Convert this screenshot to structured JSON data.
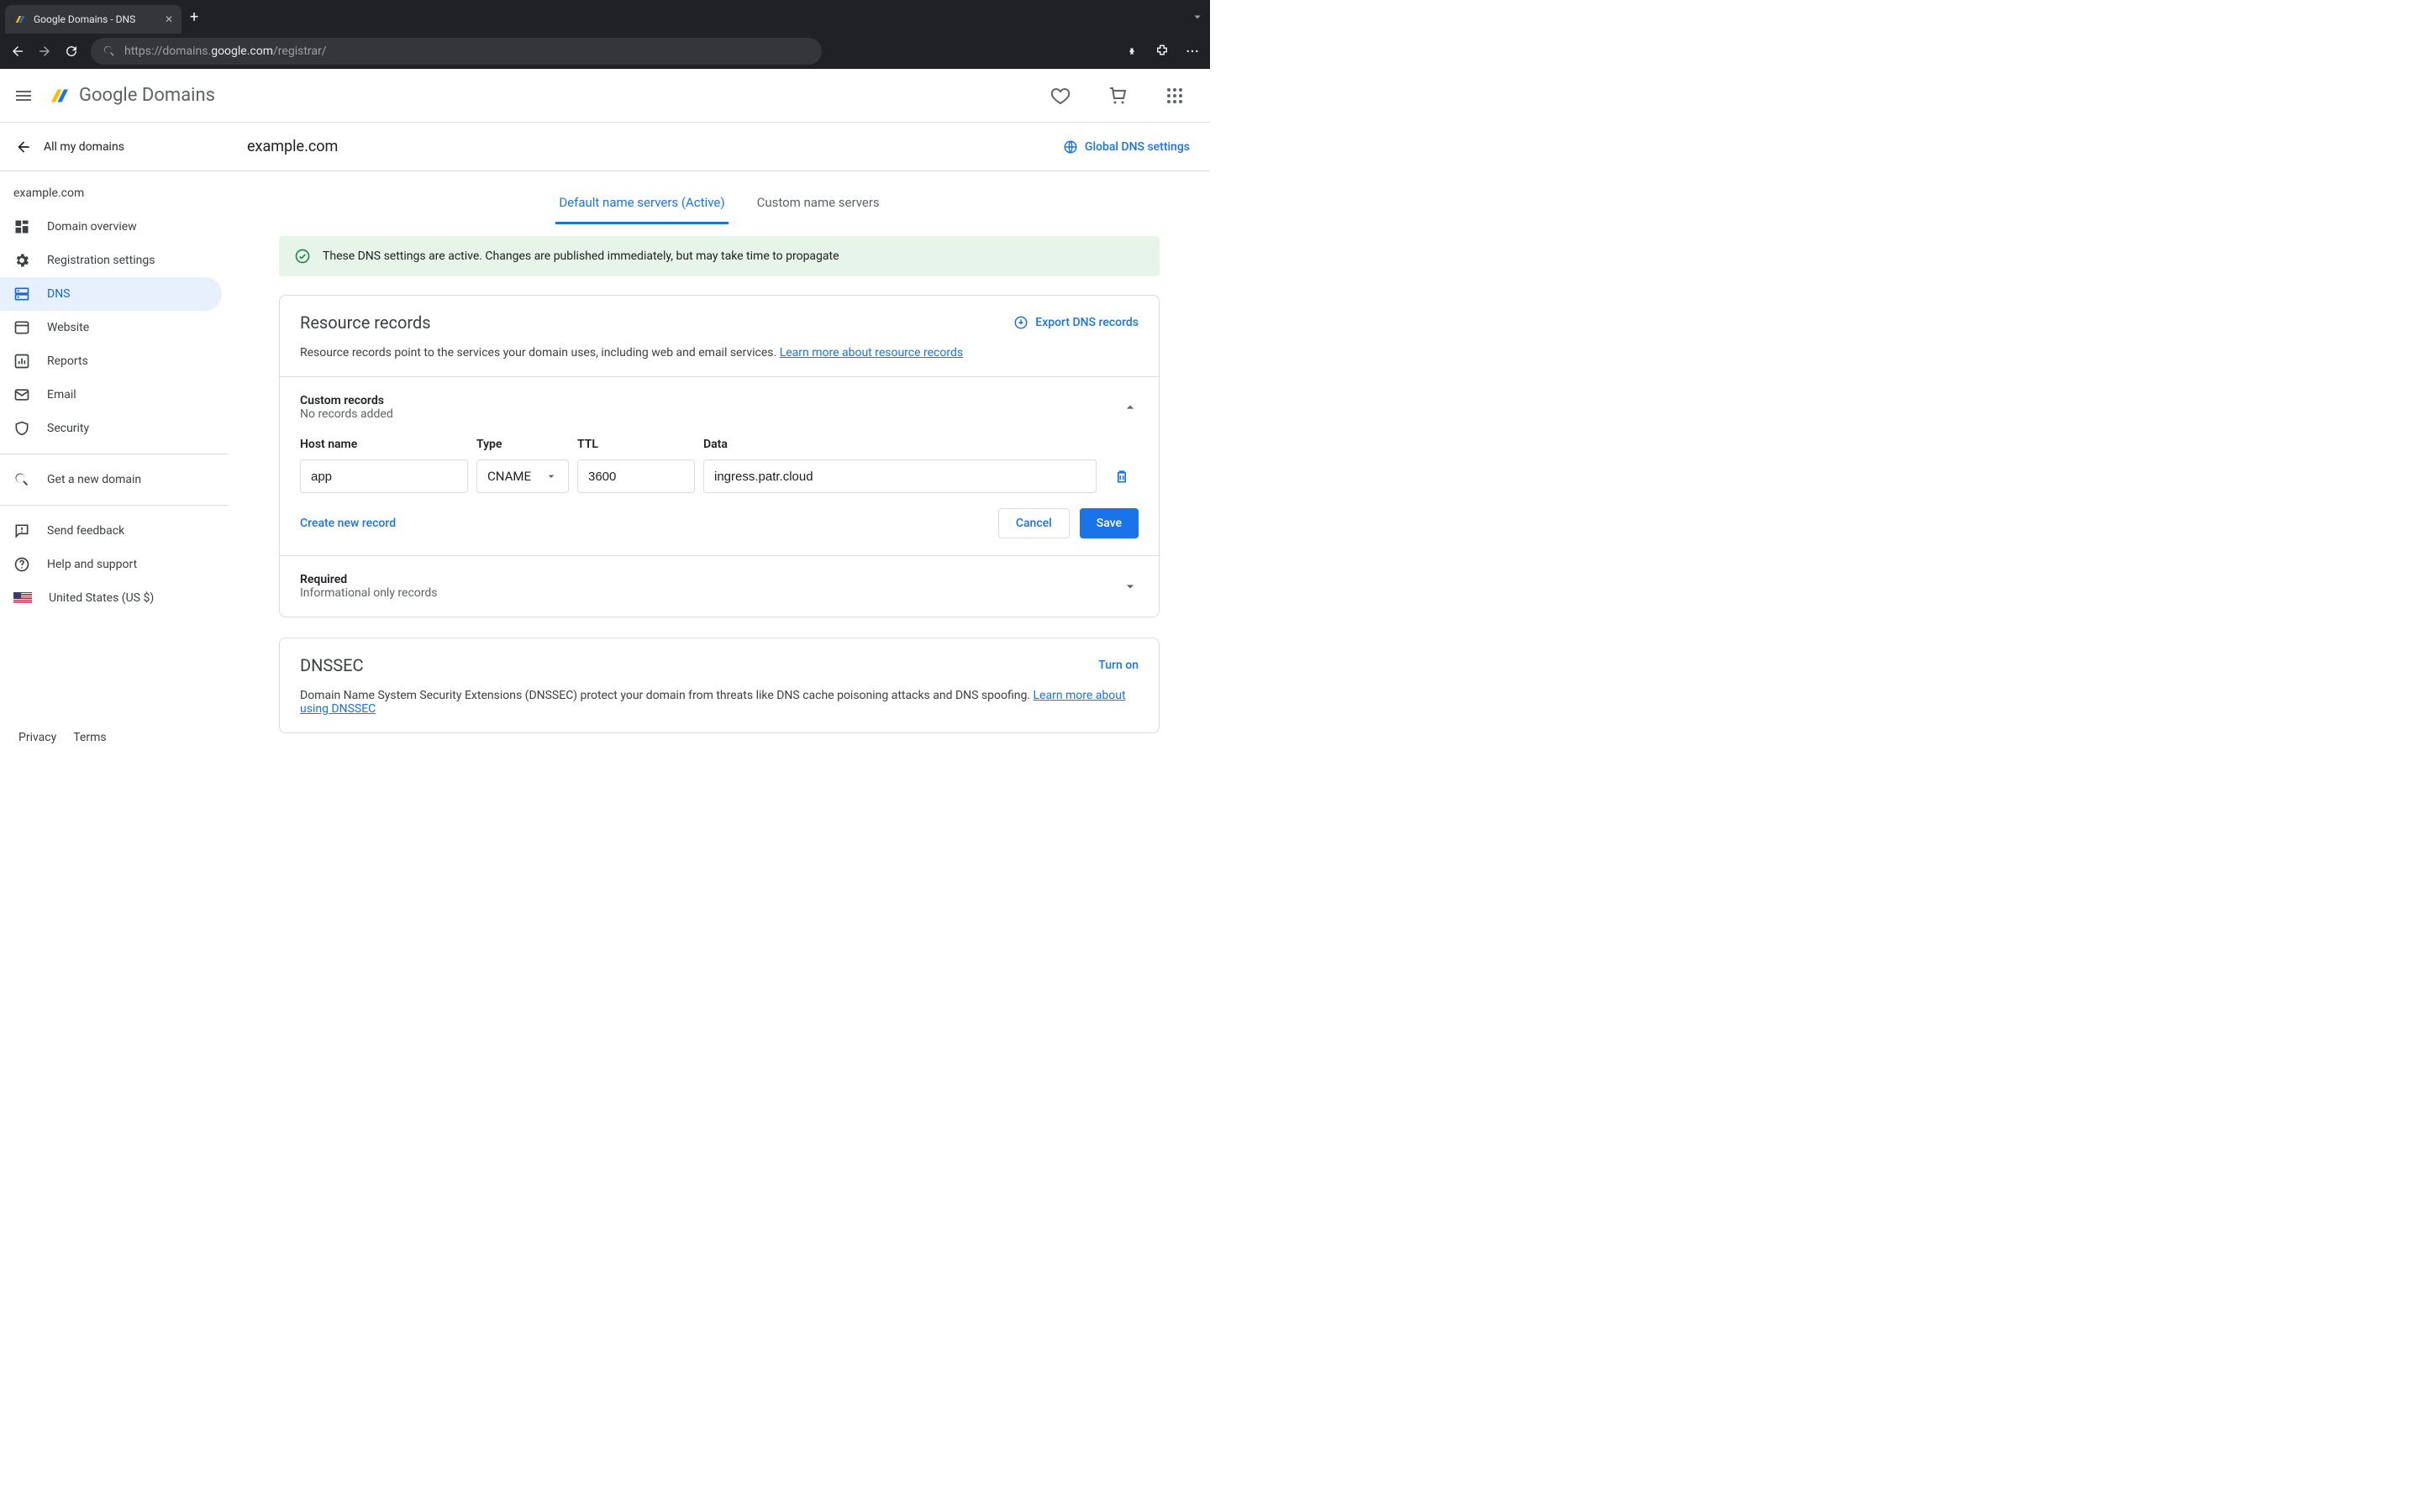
{
  "browser": {
    "tab_title": "Google Domains - DNS",
    "url_dim_pre": "https://domains.",
    "url_host": "google.com",
    "url_path": "/registrar/"
  },
  "header": {
    "product_left": "Google",
    "product_right": " Domains"
  },
  "subheader": {
    "back_label": "All my domains",
    "domain": "example.com",
    "global_dns": "Global DNS settings"
  },
  "sidebar": {
    "domain": "example.com",
    "items": [
      {
        "label": "Domain overview"
      },
      {
        "label": "Registration settings"
      },
      {
        "label": "DNS"
      },
      {
        "label": "Website"
      },
      {
        "label": "Reports"
      },
      {
        "label": "Email"
      },
      {
        "label": "Security"
      }
    ],
    "get_new": "Get a new domain",
    "feedback": "Send feedback",
    "help": "Help and support",
    "region": "United States (US $)",
    "privacy": "Privacy",
    "terms": "Terms"
  },
  "tabs": {
    "default": "Default name servers (Active)",
    "custom": "Custom name servers"
  },
  "banner": "These DNS settings are active. Changes are published immediately, but may take time to propagate",
  "resource": {
    "title": "Resource records",
    "export": "Export DNS records",
    "desc": "Resource records point to the services your domain uses, including web and email services. ",
    "learn": "Learn more about resource records"
  },
  "custom": {
    "title": "Custom records",
    "none": "No records added",
    "cols": {
      "host": "Host name",
      "type": "Type",
      "ttl": "TTL",
      "data": "Data"
    },
    "row": {
      "host": "app",
      "type": "CNAME",
      "ttl": "3600",
      "data": "ingress.patr.cloud"
    },
    "create": "Create new record",
    "cancel": "Cancel",
    "save": "Save"
  },
  "required": {
    "title": "Required",
    "sub": "Informational only records"
  },
  "dnssec": {
    "title": "DNSSEC",
    "turn_on": "Turn on",
    "desc": "Domain Name System Security Extensions (DNSSEC) protect your domain from threats like DNS cache poisoning attacks and DNS spoofing. ",
    "learn": "Learn more about using DNSSEC"
  }
}
